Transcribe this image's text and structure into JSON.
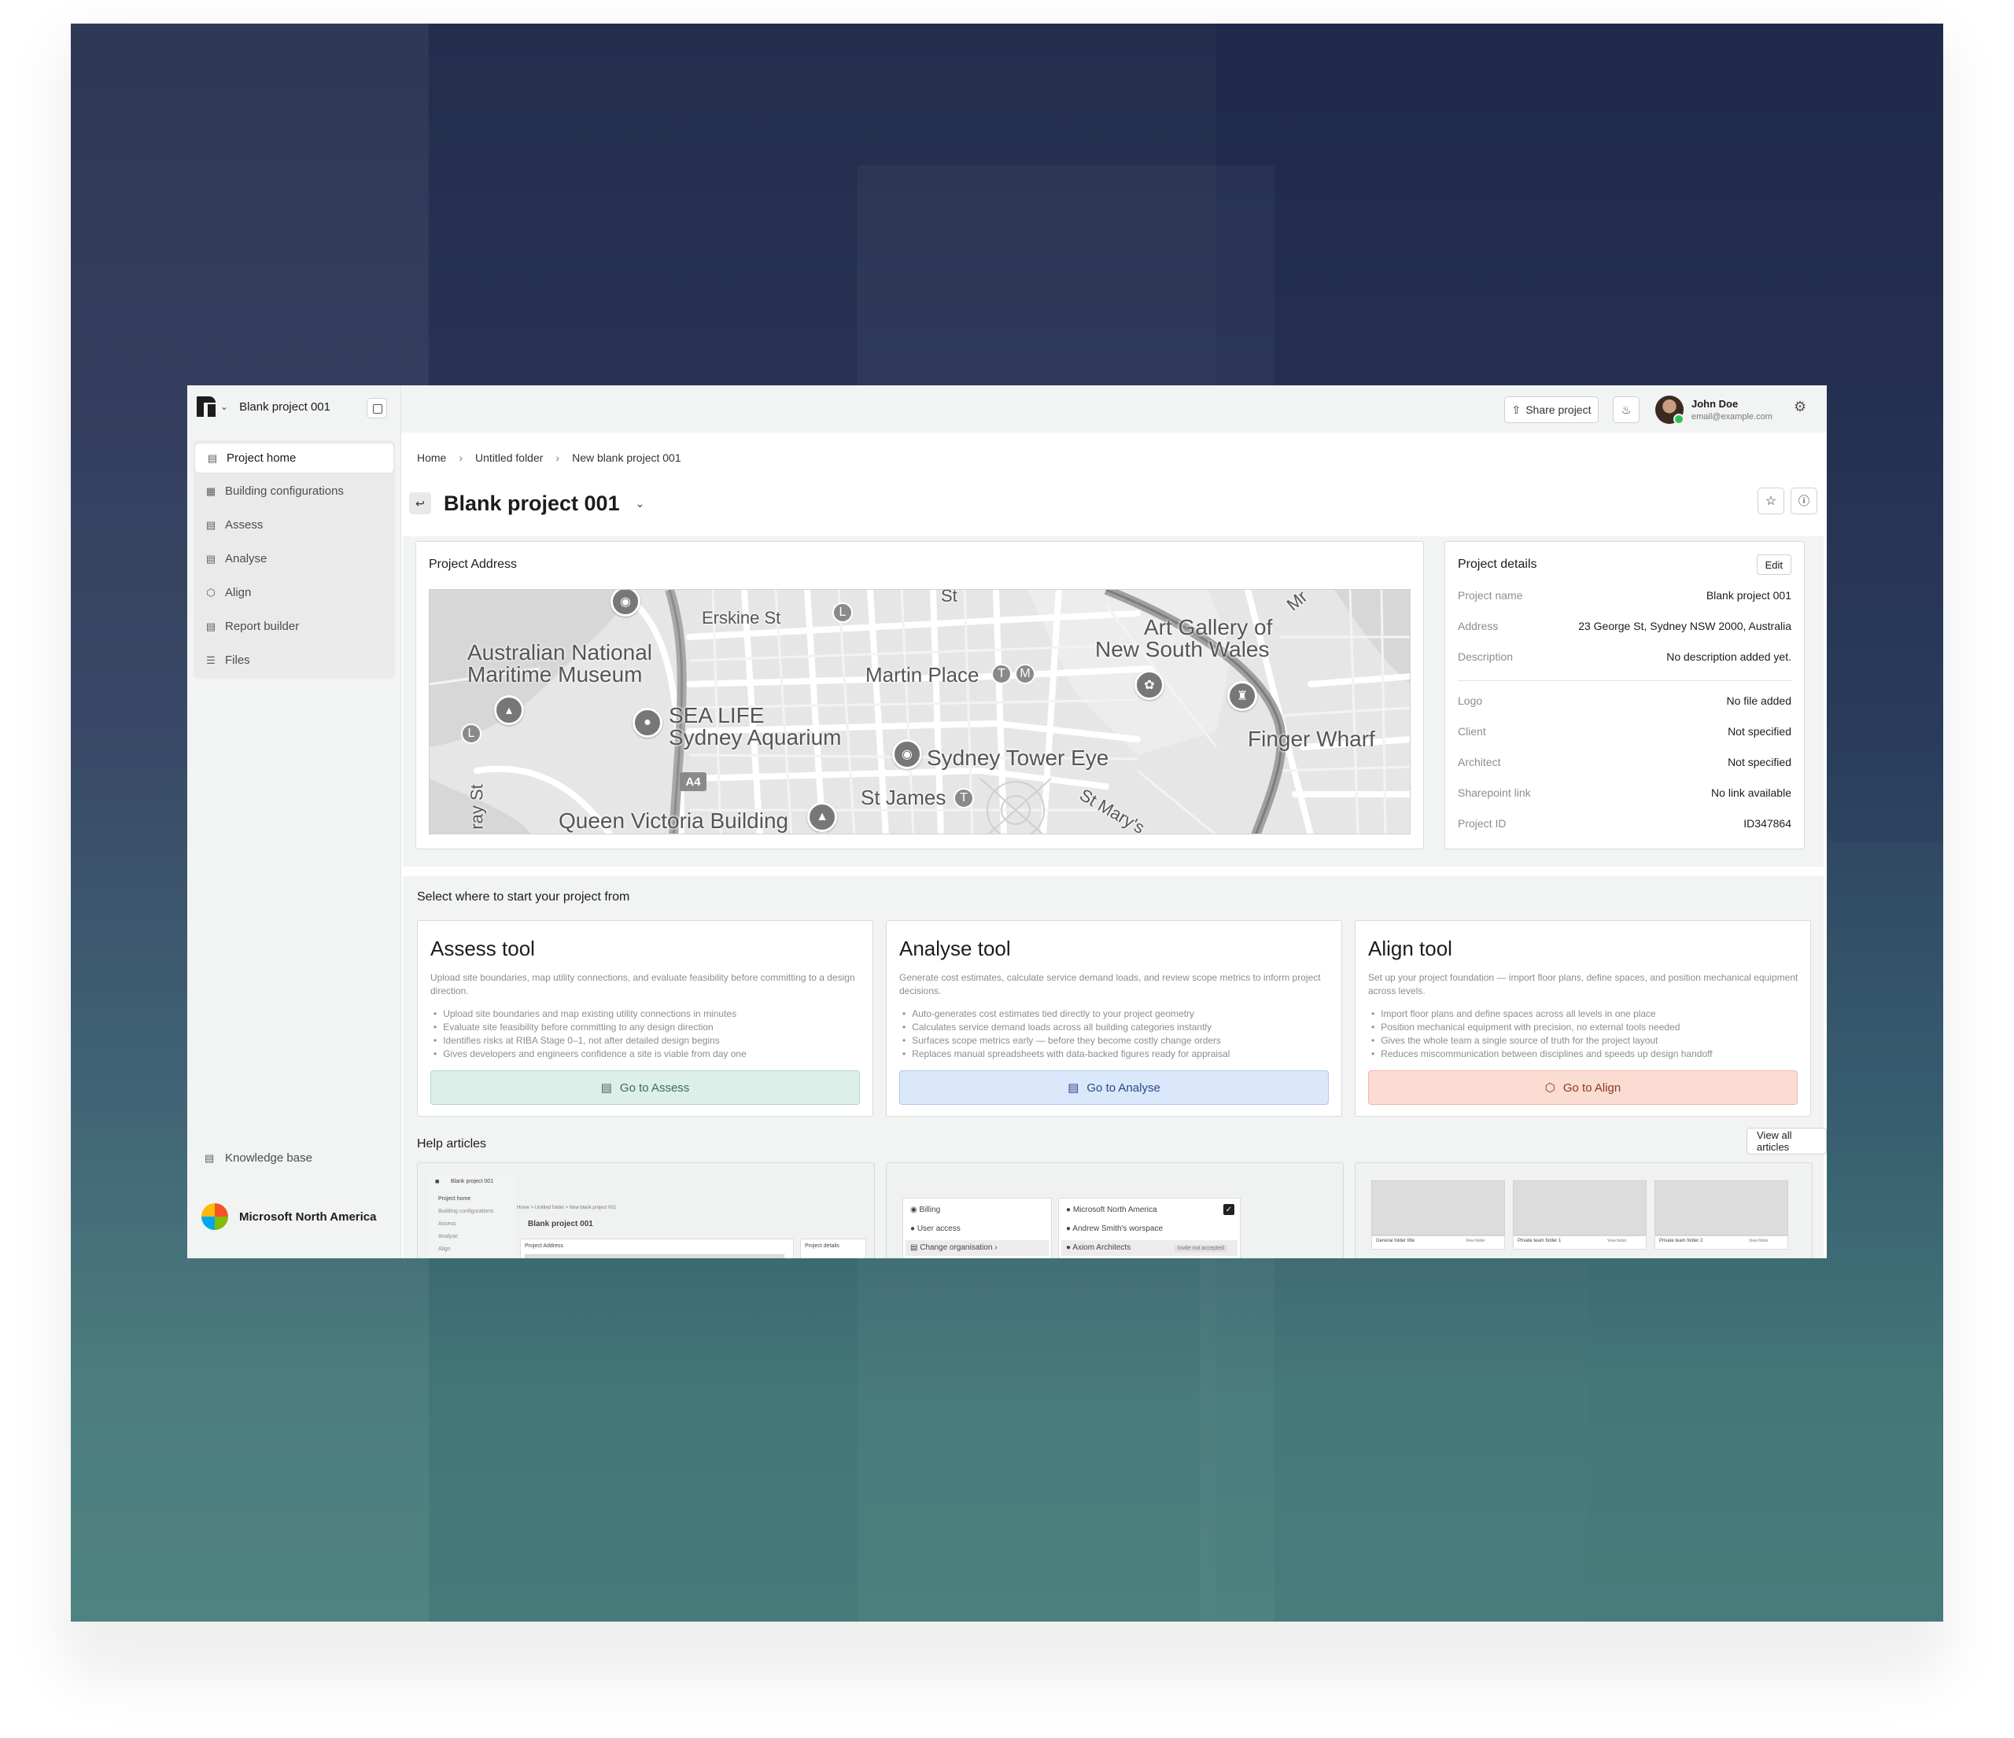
{
  "sidebar": {
    "project_name": "Blank project 001",
    "nav": [
      {
        "label": "Project home",
        "icon": "map-icon",
        "active": true
      },
      {
        "label": "Building configurations",
        "icon": "building-icon"
      },
      {
        "label": "Assess",
        "icon": "map-icon"
      },
      {
        "label": "Analyse",
        "icon": "document-icon"
      },
      {
        "label": "Align",
        "icon": "cube-icon"
      },
      {
        "label": "Report builder",
        "icon": "report-icon"
      },
      {
        "label": "Files",
        "icon": "database-icon"
      }
    ],
    "knowledge_base": "Knowledge base",
    "organisation": "Microsoft North America"
  },
  "topbar": {
    "share": "Share project",
    "user_name": "John Doe",
    "user_email": "email@example.com"
  },
  "breadcrumb": [
    "Home",
    "Untitled folder",
    "New blank project 001"
  ],
  "page_title": "Blank project 001",
  "address_card": {
    "title": "Project Address",
    "map_labels": {
      "erskine": "Erskine St",
      "st_top": "St",
      "museum_1": "Australian National",
      "museum_2": "Maritime Museum",
      "martin": "Martin Place",
      "gallery_1": "Art Gallery of",
      "gallery_2": "New South Wales",
      "sealife_1": "SEA LIFE",
      "sealife_2": "Sydney Aquarium",
      "tower": "Sydney Tower Eye",
      "finger": "Finger Wharf",
      "stjames": "St James",
      "qvb": "Queen Victoria Building",
      "a4": "A4",
      "stmary": "St Mary's",
      "ray": "ray St",
      "mr": "Mr",
      "t": "T",
      "m": "M",
      "l": "L"
    }
  },
  "details_card": {
    "title": "Project details",
    "edit": "Edit",
    "rows": [
      {
        "k": "Project name",
        "v": "Blank project 001"
      },
      {
        "k": "Address",
        "v": "23 George St, Sydney NSW 2000, Australia"
      },
      {
        "k": "Description",
        "v": "No description added yet."
      },
      {
        "k": "Logo",
        "v": "No file added"
      },
      {
        "k": "Client",
        "v": "Not specified"
      },
      {
        "k": "Architect",
        "v": "Not specified"
      },
      {
        "k": "Sharepoint link",
        "v": "No link available"
      },
      {
        "k": "Project ID",
        "v": "ID347864"
      }
    ]
  },
  "tools": {
    "heading": "Select where to start your project from",
    "cards": [
      {
        "name": "Assess tool",
        "desc": "Upload site boundaries, map utility connections, and evaluate feasibility before committing to a design direction.",
        "bullets": [
          "Upload site boundaries and map existing utility connections in minutes",
          "Evaluate site feasibility before committing to any design direction",
          "Identifies risks at RIBA Stage 0–1, not after detailed design begins",
          "Gives developers and engineers confidence a site is viable from day one"
        ],
        "button": "Go to Assess"
      },
      {
        "name": "Analyse tool",
        "desc": "Generate cost estimates, calculate service demand loads, and review scope metrics to inform project decisions.",
        "bullets": [
          "Auto-generates cost estimates tied directly to your project geometry",
          "Calculates service demand loads across all building categories instantly",
          "Surfaces scope metrics early — before they become costly change orders",
          "Replaces manual spreadsheets with data-backed figures ready for appraisal"
        ],
        "button": "Go to Analyse"
      },
      {
        "name": "Align tool",
        "desc": "Set up your project foundation — import floor plans, define spaces, and position mechanical equipment across levels.",
        "bullets": [
          "Import floor plans and define spaces across all levels in one place",
          "Position mechanical equipment with precision, no external tools needed",
          "Gives the whole team a single source of truth for the project layout",
          "Reduces miscommunication between disciplines and speeds up design handoff"
        ],
        "button": "Go to Align"
      }
    ]
  },
  "help": {
    "heading": "Help articles",
    "view_all": "View all articles",
    "thumb1": {
      "project": "Blank project 001",
      "nav": [
        "Project home",
        "Building configurations",
        "Assess",
        "Analyse",
        "Align"
      ],
      "crumbs": "Home  >  Untitled folder  >  New blank project 001",
      "title": "Blank project 001",
      "addr": "Project Address",
      "details": "Project details"
    },
    "thumb2": {
      "left": [
        "Billing",
        "User access",
        "Change organisation"
      ],
      "right": [
        "Microsoft North America",
        "Andrew Smith's worspace",
        "Axiom Architects"
      ],
      "badge": "Invite not accepted"
    },
    "thumb3": {
      "folders": [
        "General folder title",
        "Private team folder 1",
        "Private team folder 2"
      ],
      "action": "View folder"
    }
  },
  "colors": {
    "assess": "#dcefe9",
    "analyse": "#dbe7fb",
    "align": "#fbdcd2"
  }
}
